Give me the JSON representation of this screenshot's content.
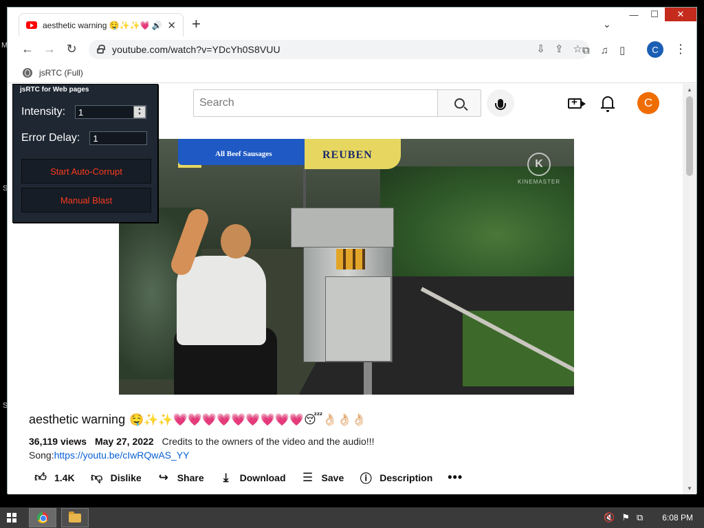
{
  "desktop": {
    "glyphs": [
      "M",
      "S",
      "S"
    ]
  },
  "browser": {
    "tab": {
      "title": "aesthetic warning 🤤✨✨💗💗",
      "audio_icon": "speaker-icon"
    },
    "new_tab_label": "+",
    "window_controls": {
      "minimize": "—",
      "maximize": "☐",
      "close": "✕"
    },
    "address": {
      "url": "youtube.com/watch?v=YDcYh0S8VUU"
    },
    "profile_initial": "C",
    "bookmark": {
      "label": "jsRTC (Full)"
    }
  },
  "youtube": {
    "search": {
      "placeholder": "Search",
      "value": ""
    },
    "avatar_initial": "C",
    "video": {
      "umbrella_left": "All Beef Sausages",
      "umbrella_right": "REUBEN",
      "watermark": "K",
      "watermark_text": "KINEMASTER"
    },
    "title": {
      "text": "aesthetic warning",
      "emoji": "🤤✨✨💗💗💗💗💗💗💗💗💗😴👌🏻👌🏻👌🏻"
    },
    "views": "36,119 views",
    "date": "May 27, 2022",
    "description": "Credits to the owners of the video and the audio!!!",
    "song_label": "Song:",
    "song_link": "https://youtu.be/cIwRQwAS_YY",
    "actions": {
      "like_count": "1.4K",
      "dislike": "Dislike",
      "share": "Share",
      "download": "Download",
      "save": "Save",
      "description": "Description",
      "more": "•••"
    }
  },
  "jsrtc": {
    "title": "jsRTC for Web pages",
    "intensity_label": "Intensity:",
    "intensity_value": "1",
    "error_delay_label": "Error Delay:",
    "error_delay_value": "1",
    "start_button": "Start Auto-Corrupt",
    "blast_button": "Manual Blast"
  },
  "taskbar": {
    "clock": "6:08 PM"
  }
}
